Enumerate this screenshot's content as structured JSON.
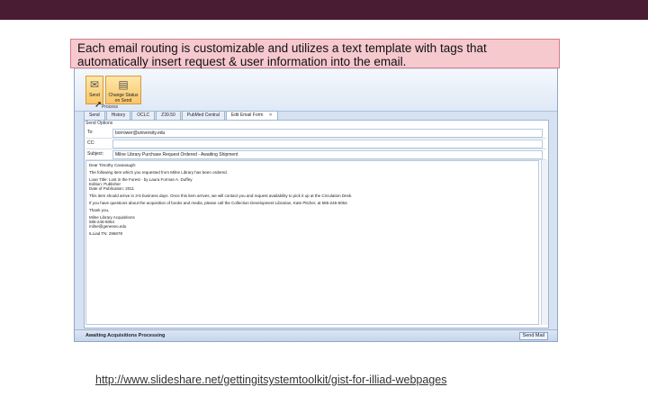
{
  "callout_text": "Each email routing is customizable and utilizes a text template with tags that automatically insert request & user information into the email.",
  "ribbon": {
    "send_label": "Send",
    "change_status_label": "Change Status on Send",
    "group_label": "Process"
  },
  "tabs": [
    "Send",
    "History",
    "OCLC",
    "Z39.50",
    "PubMed Central",
    "Edit Email Form"
  ],
  "email": {
    "send_tabs": "Send Options",
    "to_label": "To:",
    "to_value": "borrower@university.edu",
    "cc_label": "CC:",
    "cc_value": "",
    "subject_label": "Subject:",
    "subject_value": "Milne Library Purchase Request Ordered - Awaiting Shipment",
    "body": [
      "Dear Timothy Cavanaugh:",
      "The following item which you requested from Milne Library has been ordered.",
      "Loan Title: Lost in the Forest - by Laura Forman A. Duffey\nEdition: Publisher\nDate of Publication: 2011",
      "This item should arrive in 3-5 business days. Once this item arrives, we will contact you and request availability to pick it up at the Circulation Desk.",
      "If you have questions about the acquisition of books and media, please call the Collection Development Librarian, Kate Pitcher, at 585-245-5064.",
      "Thank you,",
      "Milne Library Acquisitions\n585-245-5064\nmilne@geneseo.edu",
      "ILLiad TN: 296878"
    ]
  },
  "status": {
    "queue": "Awaiting Acquisitions Processing",
    "button": "Send Mail"
  },
  "source_link": "http://www.slideshare.net/gettingitsystemtoolkit/gist-for-illiad-webpages"
}
